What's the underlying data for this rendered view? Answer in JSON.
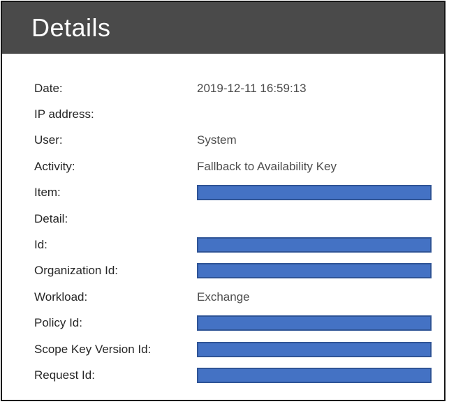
{
  "panel": {
    "title": "Details",
    "colors": {
      "header_bg": "#4a4a4a",
      "header_text": "#ffffff",
      "panel_border": "#161616",
      "label_text": "#262626",
      "value_text": "#4d4d4d",
      "redaction_fill": "#4472c4",
      "redaction_border": "#2f5496"
    },
    "rows": [
      {
        "label": "Date:",
        "type": "text",
        "value": "2019-12-11 16:59:13"
      },
      {
        "label": "IP address:",
        "type": "empty",
        "value": ""
      },
      {
        "label": "User:",
        "type": "text",
        "value": "System"
      },
      {
        "label": "Activity:",
        "type": "text",
        "value": "Fallback to Availability Key"
      },
      {
        "label": "Item:",
        "type": "redacted",
        "value": ""
      },
      {
        "label": "Detail:",
        "type": "empty",
        "value": ""
      },
      {
        "label": "Id:",
        "type": "redacted",
        "value": ""
      },
      {
        "label": "Organization Id:",
        "type": "redacted",
        "value": ""
      },
      {
        "label": "Workload:",
        "type": "text",
        "value": "Exchange"
      },
      {
        "label": "Policy Id:",
        "type": "redacted",
        "value": ""
      },
      {
        "label": "Scope Key Version Id:",
        "type": "redacted",
        "value": ""
      },
      {
        "label": "Request Id:",
        "type": "redacted",
        "value": ""
      }
    ]
  }
}
